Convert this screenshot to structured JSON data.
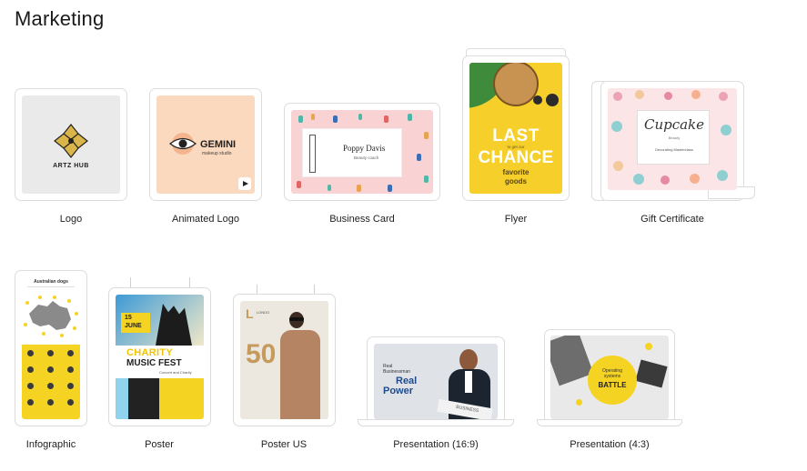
{
  "section": {
    "title": "Marketing"
  },
  "items": [
    {
      "label": "Logo",
      "logo_text": "ARTZ HUB"
    },
    {
      "label": "Animated Logo",
      "brand": "GEMINI",
      "tagline": "makeup studio"
    },
    {
      "label": "Business Card",
      "name": "Poppy Davis",
      "role": "Beauty coach"
    },
    {
      "label": "Flyer",
      "headline_1": "LAST",
      "headline_2": "CHANCE",
      "small": "to get our",
      "sub_1": "favorite",
      "sub_2": "goods"
    },
    {
      "label": "Gift Certificate",
      "script": "Cupcake",
      "small": "Beauty",
      "footer": "Decorating Masterclass"
    },
    {
      "label": "Infographic",
      "heading": "Australian dogs"
    },
    {
      "label": "Poster",
      "date_1": "15",
      "date_2": "JUNE",
      "headline_1": "CHARITY",
      "headline_2": "MUSIC FEST",
      "sub": "Concert and Charity"
    },
    {
      "label": "Poster US",
      "number": "50",
      "letter": "L",
      "brand": "LONDO"
    },
    {
      "label": "Presentation (16:9)",
      "small": "Real",
      "line_2": "Businessman",
      "big_1": "Real",
      "big_2": "Power",
      "paper": "BUSINESS"
    },
    {
      "label": "Presentation (4:3)",
      "small_1": "Operating",
      "small_2": "systems",
      "badge": "BATTLE"
    }
  ],
  "colors": {
    "accent_yellow": "#f5d322",
    "peach": "#fad9be",
    "frame_border": "#dcdcdc"
  }
}
